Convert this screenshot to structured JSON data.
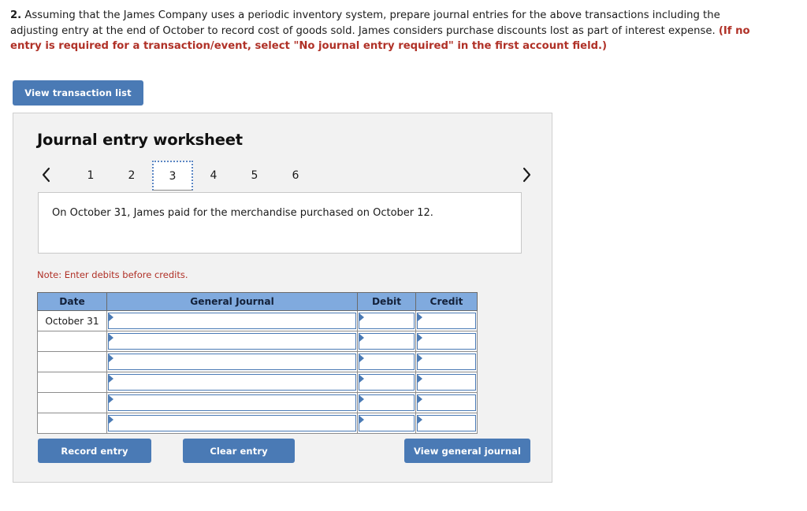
{
  "question": {
    "number": "2.",
    "body": " Assuming that the James Company uses a periodic inventory system, prepare journal entries for the above transactions including the adjusting entry at the end of October to record cost of goods sold. James considers purchase discounts lost as part of interest expense. ",
    "emphasis": "(If no entry is required for a transaction/event, select \"No journal entry required\" in the first account field.)"
  },
  "toolbar": {
    "view_transaction_list_label": "View transaction list"
  },
  "worksheet": {
    "title": "Journal entry worksheet",
    "prev_icon": "chevron-left-icon",
    "next_icon": "chevron-right-icon",
    "tabs": [
      {
        "label": "1",
        "selected": false
      },
      {
        "label": "2",
        "selected": false
      },
      {
        "label": "3",
        "selected": true
      },
      {
        "label": "4",
        "selected": false
      },
      {
        "label": "5",
        "selected": false
      },
      {
        "label": "6",
        "selected": false
      }
    ],
    "description": "On October 31, James paid for the merchandise purchased on October 12.",
    "note": "Note: Enter debits before credits."
  },
  "journal_table": {
    "headers": [
      "Date",
      "General Journal",
      "Debit",
      "Credit"
    ],
    "rows": [
      {
        "date": "October 31",
        "general_journal": "",
        "debit": "",
        "credit": ""
      },
      {
        "date": "",
        "general_journal": "",
        "debit": "",
        "credit": ""
      },
      {
        "date": "",
        "general_journal": "",
        "debit": "",
        "credit": ""
      },
      {
        "date": "",
        "general_journal": "",
        "debit": "",
        "credit": ""
      },
      {
        "date": "",
        "general_journal": "",
        "debit": "",
        "credit": ""
      },
      {
        "date": "",
        "general_journal": "",
        "debit": "",
        "credit": ""
      }
    ]
  },
  "actions": {
    "record_entry_label": "Record entry",
    "clear_entry_label": "Clear entry",
    "view_general_journal_label": "View general journal"
  },
  "colors": {
    "button_blue": "#4a7ab5",
    "table_header_blue": "#80aade",
    "panel_background": "#f2f2f2",
    "note_red": "#b03127",
    "cell_border_blue": "#4a7ab5"
  }
}
